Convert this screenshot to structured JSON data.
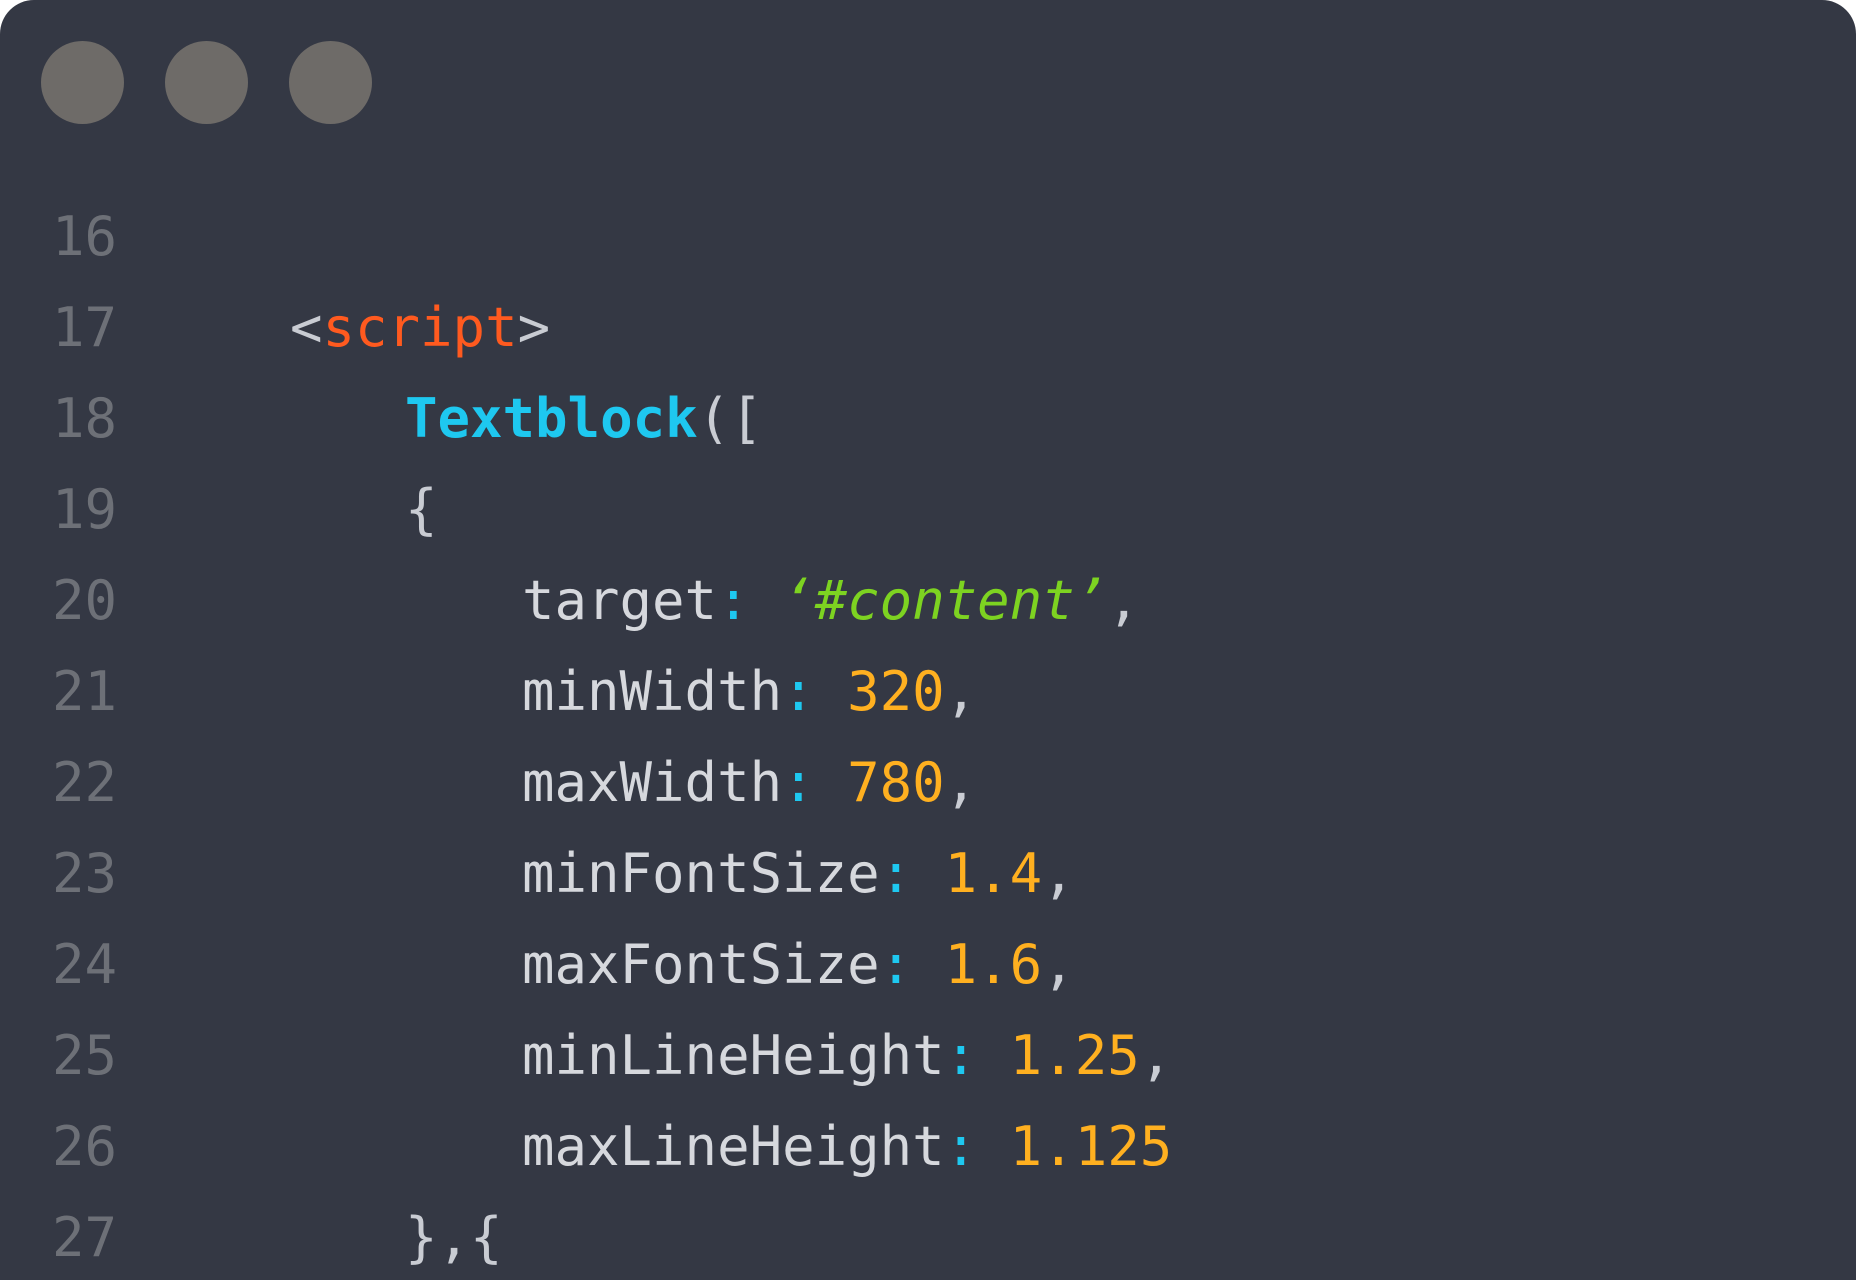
{
  "window": {
    "traffic_lights": [
      "dot",
      "dot",
      "dot"
    ]
  },
  "colors": {
    "background": "#343844",
    "dot": "#6e6b68",
    "line_number": "#6d7077",
    "punctuation": "#c9ccd3",
    "tag": "#ff5a1f",
    "function": "#1ec8f0",
    "key": "#d6d8dd",
    "colon": "#1ec8f0",
    "number": "#ffb020",
    "string": "#7dd321"
  },
  "editor": {
    "lines": [
      {
        "number": "16"
      },
      {
        "number": "17",
        "open": "<",
        "tag": "script",
        "close": ">"
      },
      {
        "number": "18",
        "fn": "Textblock",
        "punct": "(["
      },
      {
        "number": "19",
        "brace": "{"
      },
      {
        "number": "20",
        "key": "target",
        "colon": ":",
        "value": "‘#content’",
        "comma": ","
      },
      {
        "number": "21",
        "key": "minWidth",
        "colon": ":",
        "value": "320",
        "comma": ","
      },
      {
        "number": "22",
        "key": "maxWidth",
        "colon": ":",
        "value": "780",
        "comma": ","
      },
      {
        "number": "23",
        "key": "minFontSize",
        "colon": ":",
        "value": "1.4",
        "comma": ","
      },
      {
        "number": "24",
        "key": "maxFontSize",
        "colon": ":",
        "value": "1.6",
        "comma": ","
      },
      {
        "number": "25",
        "key": "minLineHeight",
        "colon": ":",
        "value": "1.25",
        "comma": ","
      },
      {
        "number": "26",
        "key": "maxLineHeight",
        "colon": ":",
        "value": "1.125"
      },
      {
        "number": "27",
        "brace": "},{"
      }
    ]
  }
}
